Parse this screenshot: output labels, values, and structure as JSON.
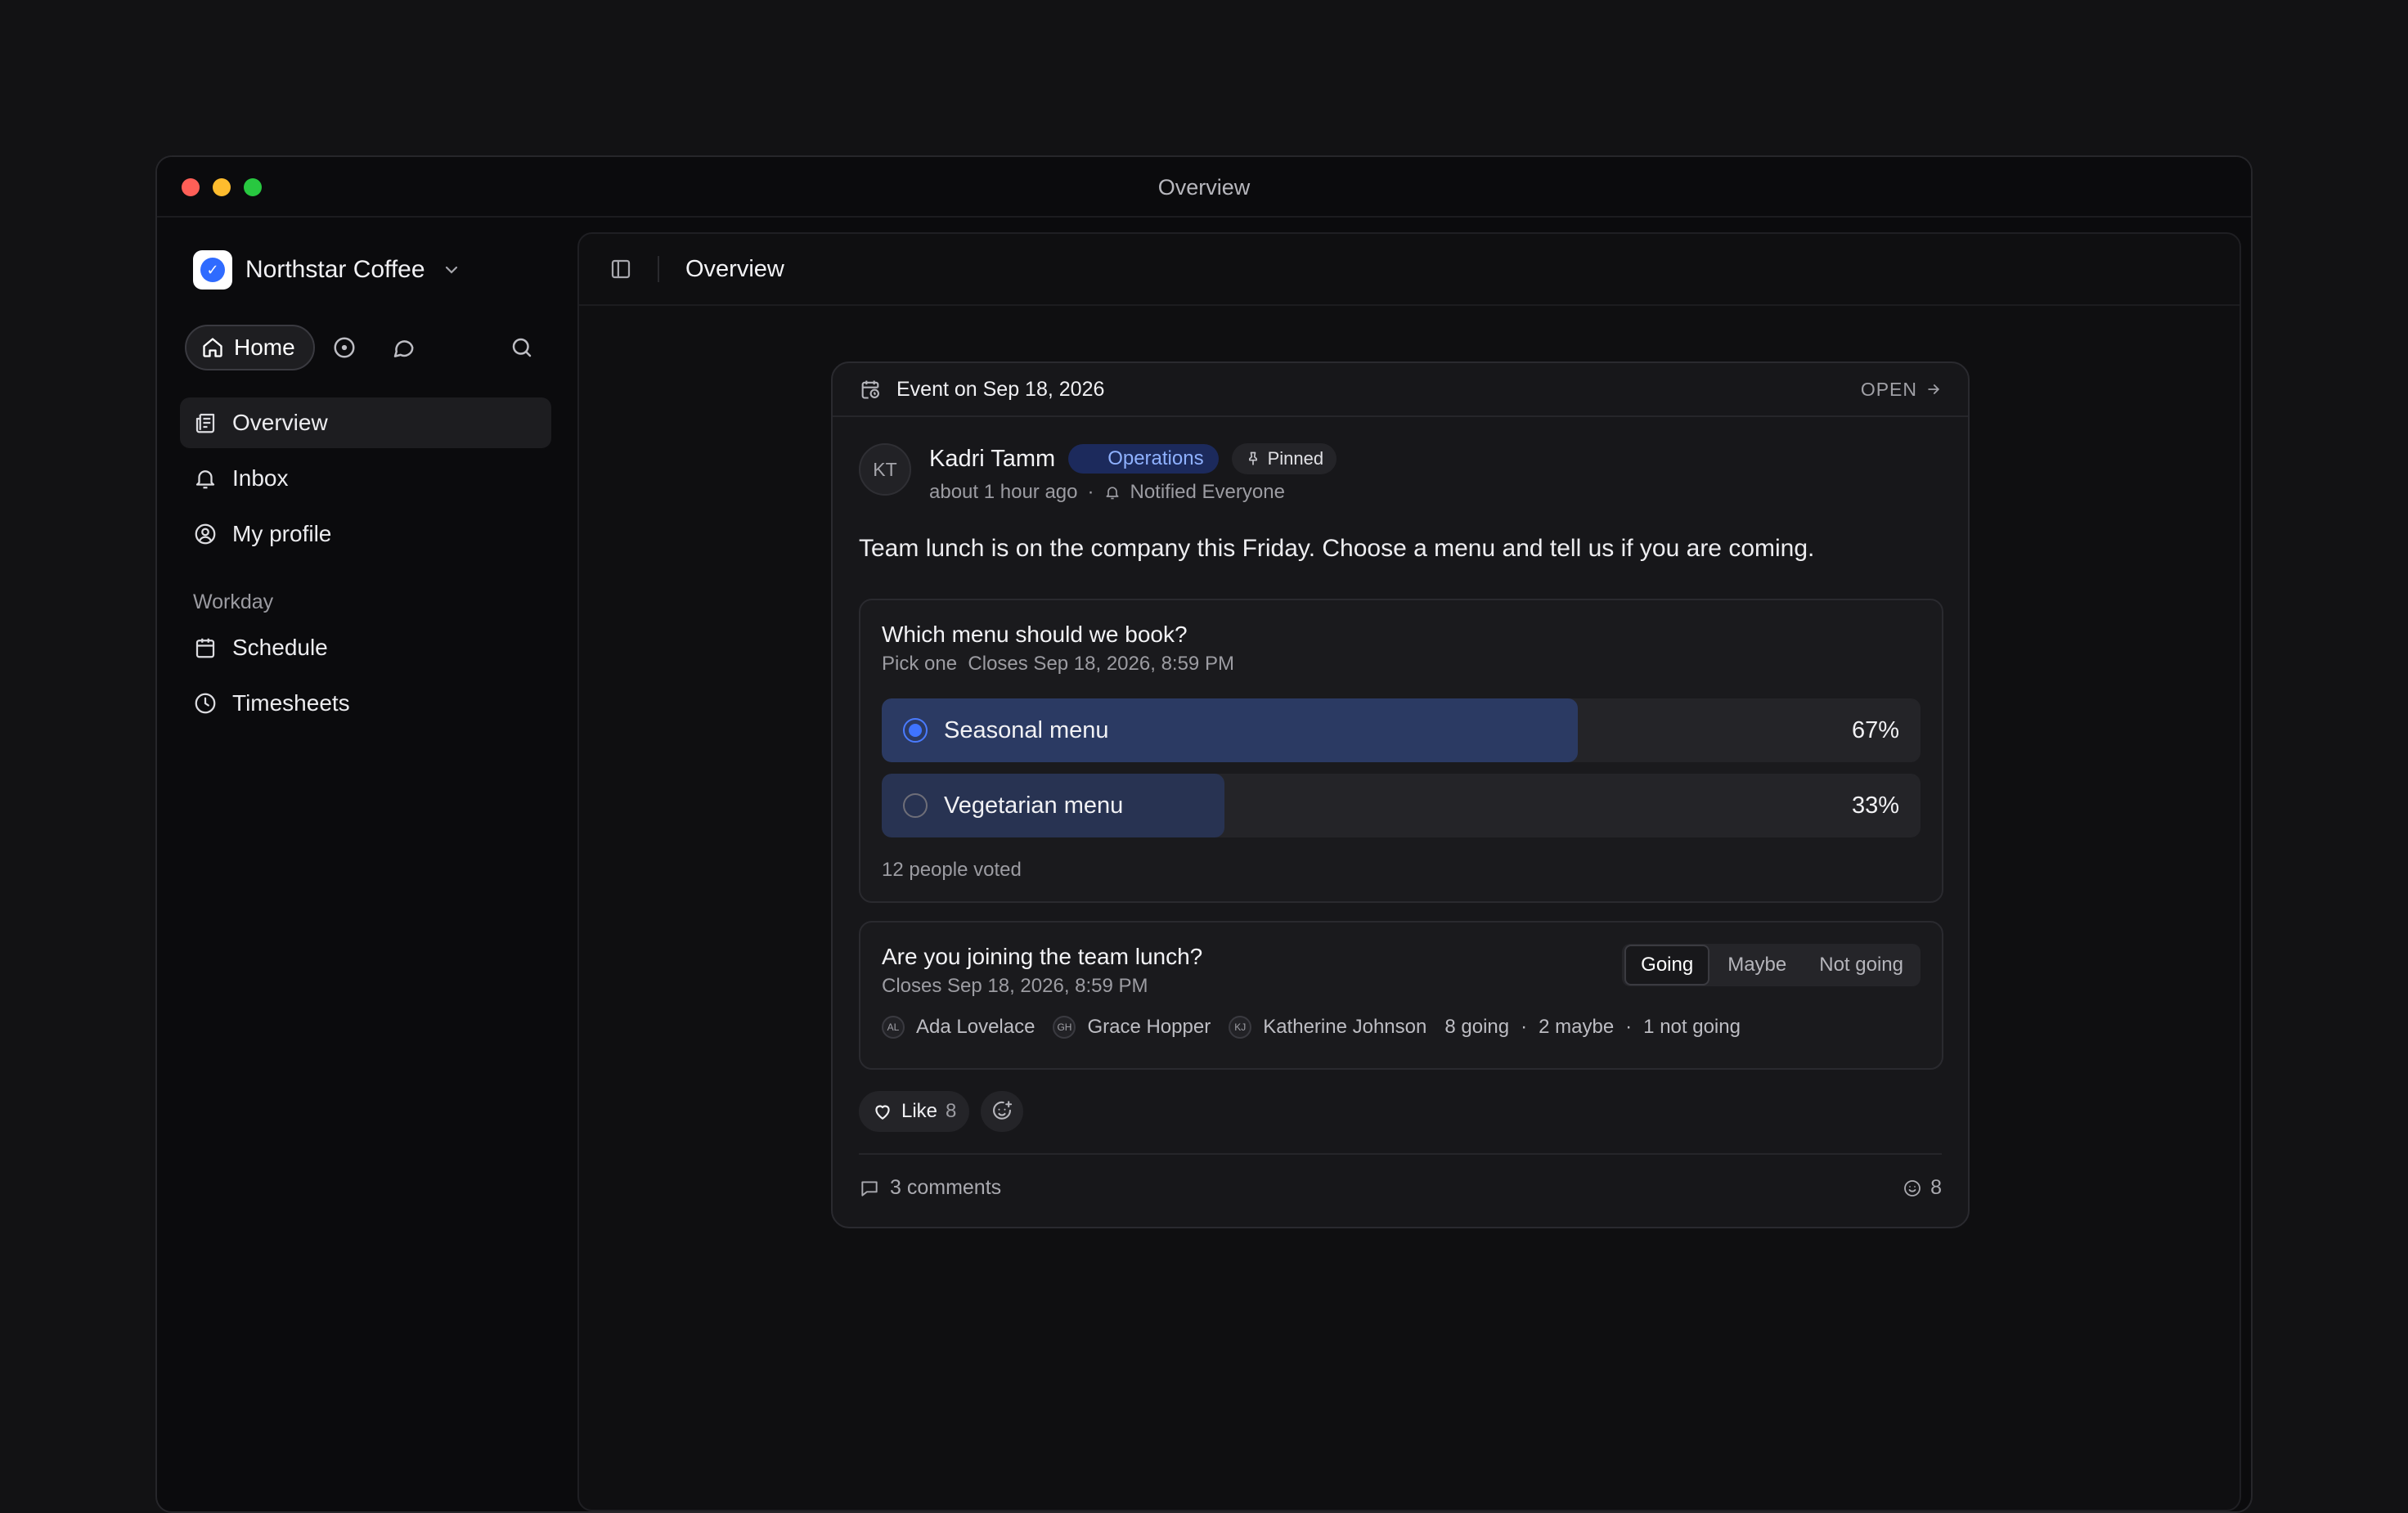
{
  "window": {
    "title": "Overview"
  },
  "sidebar": {
    "workspace_name": "Northstar Coffee",
    "home_label": "Home",
    "items": [
      {
        "label": "Overview",
        "icon": "newspaper-icon",
        "active": true
      },
      {
        "label": "Inbox",
        "icon": "bell-icon"
      },
      {
        "label": "My profile",
        "icon": "user-circle-icon"
      }
    ],
    "section_label": "Workday",
    "section_items": [
      {
        "label": "Schedule",
        "icon": "calendar-icon"
      },
      {
        "label": "Timesheets",
        "icon": "clock-icon"
      }
    ]
  },
  "main": {
    "title": "Overview"
  },
  "post": {
    "event_label": "Event on Sep 18, 2026",
    "open_label": "OPEN",
    "author_initials": "KT",
    "author_name": "Kadri Tamm",
    "team_tag": "Operations",
    "pinned_label": "Pinned",
    "time_ago": "about 1 hour ago",
    "notified": "Notified Everyone",
    "body": "Team lunch is on the company this Friday. Choose a menu and tell us if you are coming.",
    "poll": {
      "question": "Which menu should we book?",
      "mode": "Pick one",
      "closes": "Closes Sep 18, 2026, 8:59 PM",
      "options": [
        {
          "label": "Seasonal menu",
          "percent": "67%",
          "fraction": 0.67,
          "selected": true
        },
        {
          "label": "Vegetarian menu",
          "percent": "33%",
          "fraction": 0.33,
          "selected": false
        }
      ],
      "voters": "12 people voted"
    },
    "rsvp": {
      "question": "Are you joining the team lunch?",
      "closes": "Closes Sep 18, 2026, 8:59 PM",
      "choices": [
        "Going",
        "Maybe",
        "Not going"
      ],
      "selected": "Going",
      "attendees": [
        {
          "initials": "AL",
          "name": "Ada Lovelace"
        },
        {
          "initials": "GH",
          "name": "Grace Hopper"
        },
        {
          "initials": "KJ",
          "name": "Katherine Johnson"
        }
      ],
      "going": "8 going",
      "maybe": "2 maybe",
      "not_going": "1 not going"
    },
    "like_label": "Like",
    "like_count": "8",
    "comments": "3 comments",
    "reactions_count": "8"
  },
  "colors": {
    "accent": "#3f74ff",
    "tag_bg": "#1c2a5c",
    "tag_text": "#8fb1ff"
  }
}
